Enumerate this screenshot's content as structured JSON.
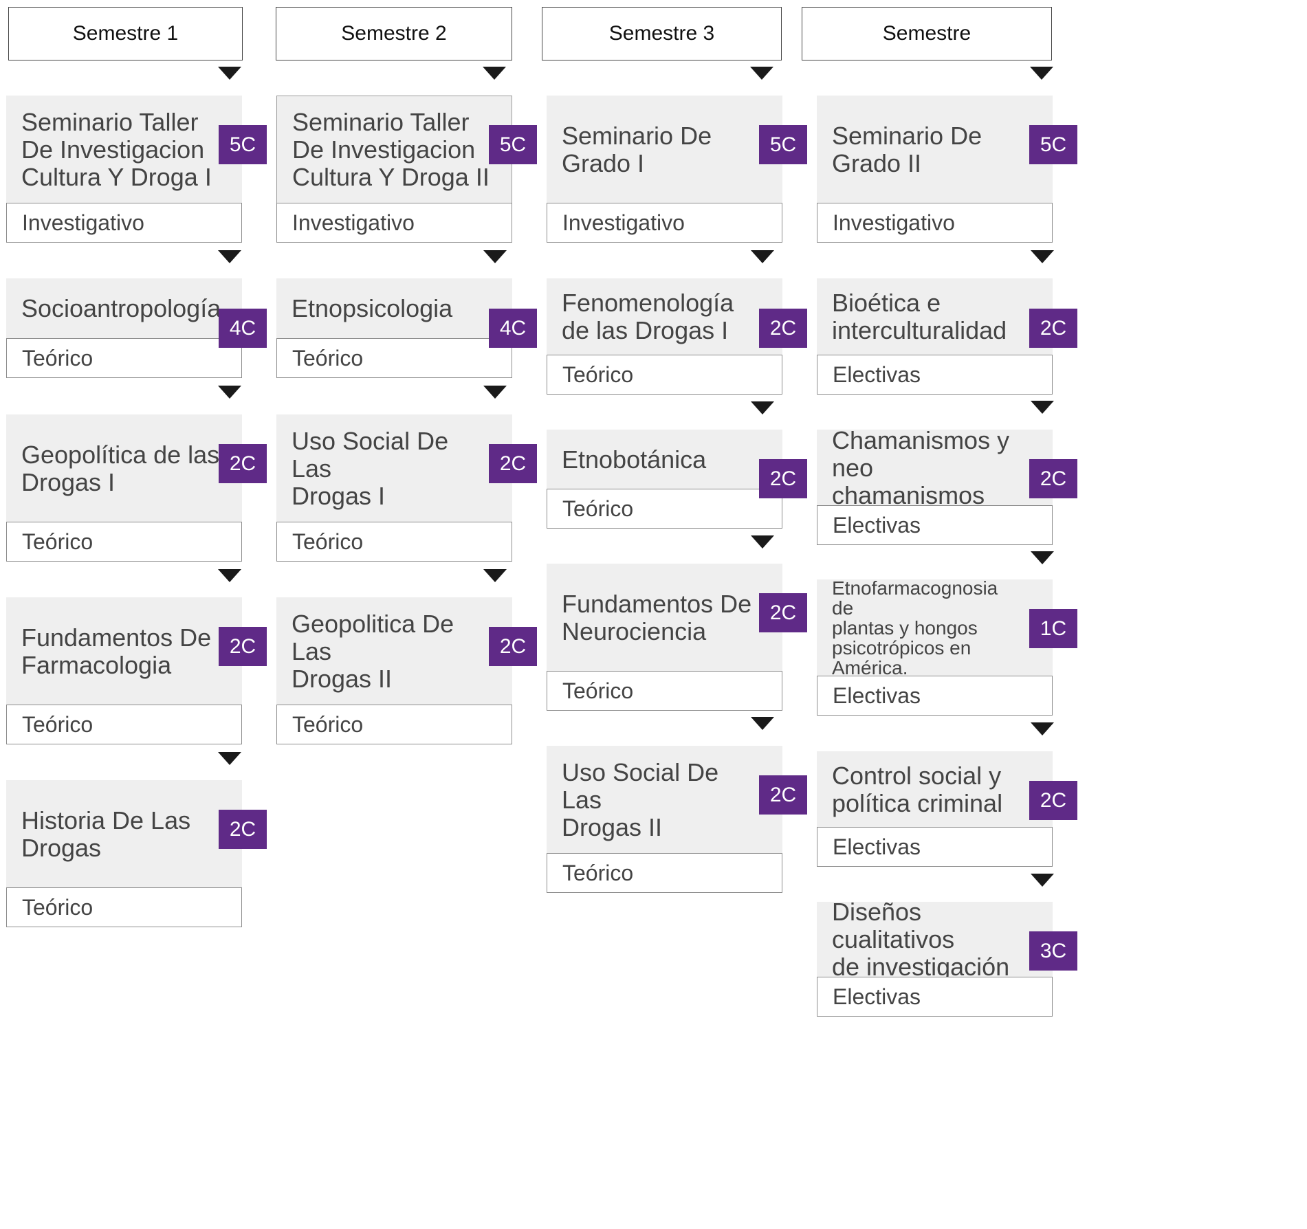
{
  "columns": [
    {
      "header": "Semestre 1",
      "courses": [
        {
          "title": "Seminario Taller\nDe Investigacion\nCultura Y Droga I",
          "credits": "5C",
          "type": "Investigativo"
        },
        {
          "title": "Socioantropología",
          "credits": "4C",
          "type": "Teórico"
        },
        {
          "title": "Geopolítica de las\nDrogas I",
          "credits": "2C",
          "type": "Teórico"
        },
        {
          "title": "Fundamentos De\nFarmacologia",
          "credits": "2C",
          "type": "Teórico"
        },
        {
          "title": "Historia De Las\nDrogas",
          "credits": "2C",
          "type": "Teórico"
        }
      ]
    },
    {
      "header": "Semestre 2",
      "courses": [
        {
          "title": "Seminario Taller\nDe Investigacion\nCultura Y Droga II",
          "credits": "5C",
          "type": "Investigativo"
        },
        {
          "title": "Etnopsicologia",
          "credits": "4C",
          "type": "Teórico"
        },
        {
          "title": "Uso Social De Las\nDrogas I",
          "credits": "2C",
          "type": "Teórico"
        },
        {
          "title": "Geopolitica De Las\nDrogas II",
          "credits": "2C",
          "type": "Teórico"
        }
      ]
    },
    {
      "header": "Semestre 3",
      "courses": [
        {
          "title": "Seminario De\nGrado I",
          "credits": "5C",
          "type": "Investigativo"
        },
        {
          "title": "Fenomenología\nde las Drogas I",
          "credits": "2C",
          "type": "Teórico"
        },
        {
          "title": "Etnobotánica",
          "credits": "2C",
          "type": "Teórico"
        },
        {
          "title": "Fundamentos De\nNeurociencia",
          "credits": "2C",
          "type": "Teórico"
        },
        {
          "title": "Uso Social De Las\nDrogas II",
          "credits": "2C",
          "type": "Teórico"
        }
      ]
    },
    {
      "header": "Semestre",
      "courses": [
        {
          "title": "Seminario De\nGrado II",
          "credits": "5C",
          "type": "Investigativo"
        },
        {
          "title": "Bioética e\ninterculturalidad",
          "credits": "2C",
          "type": "Electivas"
        },
        {
          "title": "Chamanismos y\nneo chamanismos",
          "credits": "2C",
          "type": "Electivas"
        },
        {
          "title": "Etnofarmacognosia de\nplantas y hongos\npsicotrópicos en\nAmérica.",
          "credits": "1C",
          "type": "Electivas"
        },
        {
          "title": "Control social y\npolítica criminal",
          "credits": "2C",
          "type": "Electivas"
        },
        {
          "title": "Diseños cualitativos\nde investigación",
          "credits": "3C",
          "type": "Electivas"
        }
      ]
    }
  ],
  "colors": {
    "credit_badge": "#5f2a87",
    "title_bg": "#efefef",
    "arrow": "#1a1a1a"
  }
}
